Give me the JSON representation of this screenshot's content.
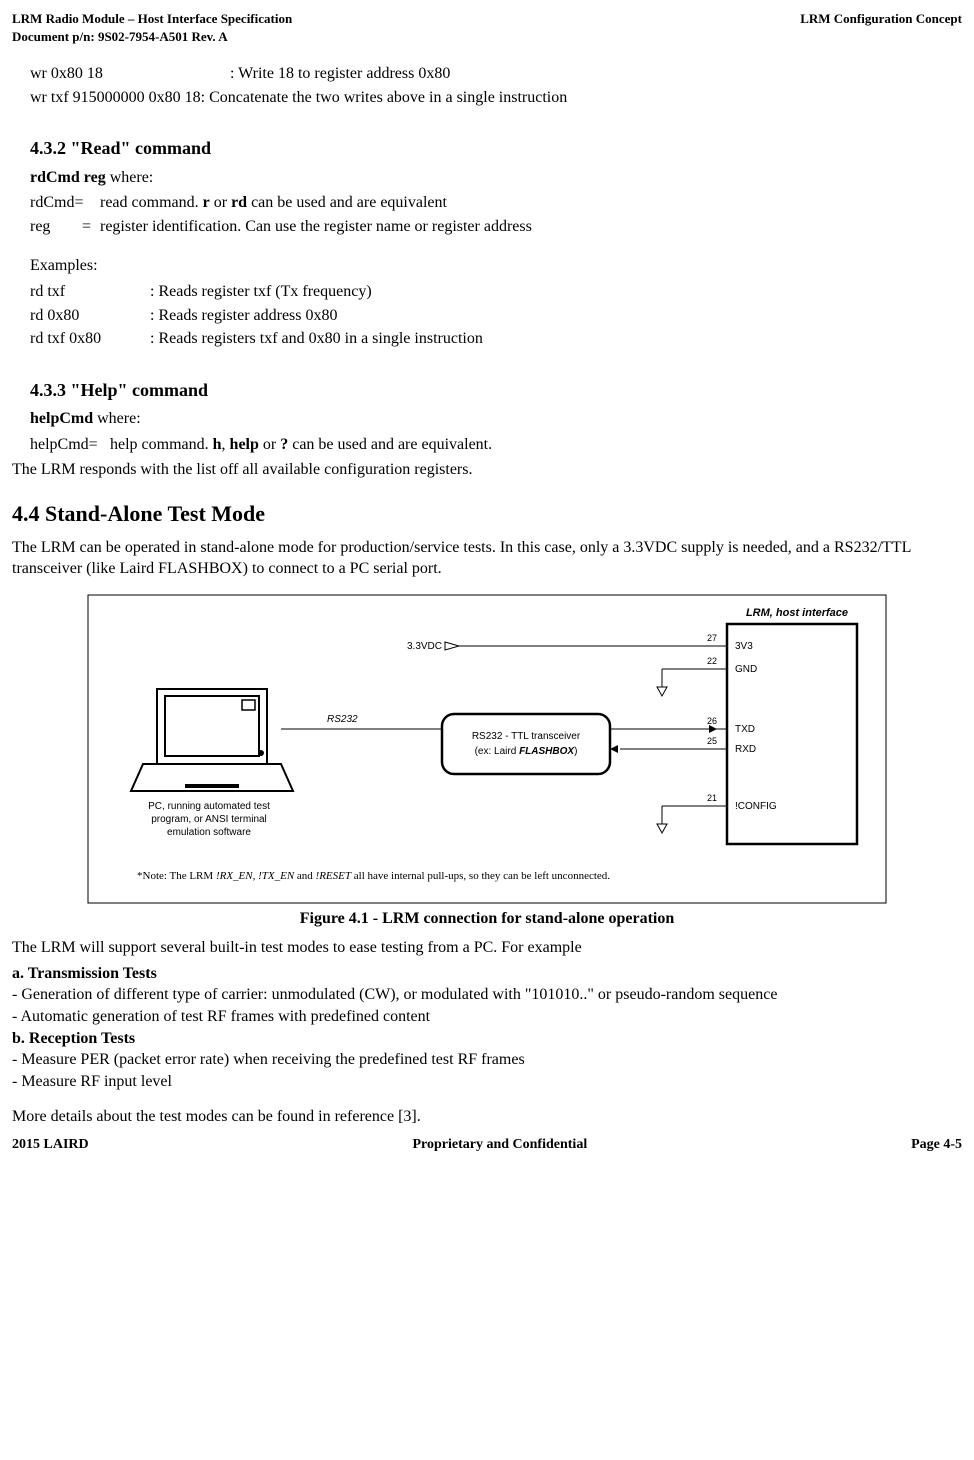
{
  "header": {
    "left_line1": "LRM Radio Module – Host Interface Specification",
    "left_line2": "Document p/n: 9S02-7954-A501 Rev. A",
    "right": "LRM Configuration Concept"
  },
  "body": {
    "wr_ex1_cmd": "wr 0x80 18",
    "wr_ex1_desc": ": Write 18 to register address 0x80",
    "wr_ex2": "wr txf 915000000 0x80 18: Concatenate the two writes above in a single instruction",
    "h_432": "4.3.2 \"Read\" command",
    "rd_syntax_cmd": " rdCmd reg",
    "rd_syntax_where": "   where:",
    "rd_def1_key": "rdCmd=",
    "rd_def1_val_pre": "read command.  ",
    "rd_def1_r": "r",
    "rd_def1_or": " or ",
    "rd_def1_rd": "rd",
    "rd_def1_tail": " can be used and are equivalent",
    "rd_def2_key": "reg",
    "rd_def2_eq": "=",
    "rd_def2_val": "register identification. Can use the register name or register address",
    "examples_label": "Examples:",
    "rd_ex1_cmd": "rd txf",
    "rd_ex1_desc": ": Reads register txf (Tx frequency)",
    "rd_ex2_cmd": "rd 0x80",
    "rd_ex2_desc": ": Reads register address 0x80",
    "rd_ex3_cmd": "rd txf 0x80",
    "rd_ex3_desc": ": Reads registers txf and 0x80 in a single instruction",
    "h_433": "4.3.3 \"Help\" command",
    "help_syntax_cmd": " helpCmd",
    "help_syntax_where": "   where:",
    "help_def_key": "helpCmd=",
    "help_def_pre": "help command.  ",
    "help_def_h": "h",
    "help_def_c1": ", ",
    "help_def_help": "help",
    "help_def_c2": " or ",
    "help_def_q": "?",
    "help_def_tail": " can be used and are equivalent.",
    "help_resp": "The LRM responds with the list off all available configuration registers.",
    "h_44": "4.4   Stand-Alone Test Mode",
    "p_44": "The LRM can be operated in stand-alone mode for production/service tests.  In this case, only a 3.3VDC supply is needed, and a RS232/TTL transceiver (like Laird FLASHBOX) to connect to a PC serial port.",
    "fig_caption": "Figure 4.1 - LRM connection for stand-alone operation",
    "p_after_fig": "The LRM will support several built-in test modes to ease testing from a PC.  For example",
    "a_head": "a. Transmission Tests",
    "a_line1": "- Generation of different type of carrier: unmodulated (CW), or modulated with \"101010..\" or pseudo-random sequence",
    "a_line2": "- Automatic generation of test RF frames with predefined content",
    "b_head": "b. Reception Tests",
    "b_line1": "- Measure PER (packet error rate) when receiving the predefined test RF frames",
    "b_line2": "- Measure RF input level",
    "more_details": "More details about the test modes can be found in reference [3]."
  },
  "figure": {
    "label_lrm": "LRM, host interface",
    "label_33v": "3.3VDC",
    "pin27": "27",
    "pin22": "22",
    "pin26": "26",
    "pin25": "25",
    "pin21": "21",
    "sig_3v3": "3V3",
    "sig_gnd": "GND",
    "sig_txd": "TXD",
    "sig_rxd": "RXD",
    "sig_config": "!CONFIG",
    "rs232": "RS232",
    "transceiver_l1": "RS232 - TTL transceiver",
    "transceiver_l2a": "(ex: Laird ",
    "transceiver_l2b": "FLASHBOX",
    "transceiver_l2c": ")",
    "pc_l1": "PC, running automated test",
    "pc_l2": "program, or ANSI terminal",
    "pc_l3": "emulation software",
    "note_pre": "*Note: The LRM ",
    "note_sig": "!RX_EN, !TX_EN",
    "note_and": " and ",
    "note_reset": "!RESET",
    "note_tail": " all have internal pull-ups, so they can be left unconnected."
  },
  "footer": {
    "left": "2015 LAIRD",
    "center": "Proprietary and Confidential",
    "right": "Page  4-5"
  }
}
